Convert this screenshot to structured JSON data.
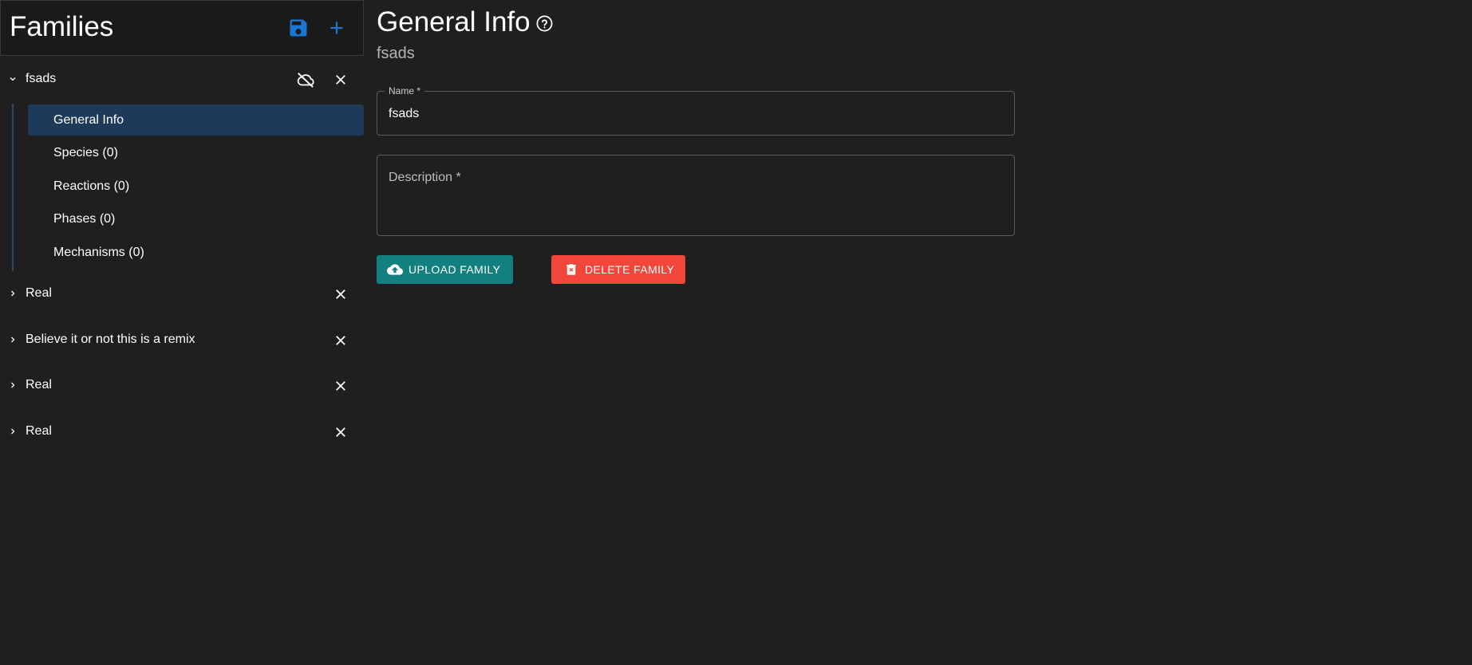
{
  "sidebar": {
    "title": "Families",
    "families": [
      {
        "label": "fsads",
        "expanded": true,
        "cloud_status": "not-uploaded"
      },
      {
        "label": "Real",
        "expanded": false
      },
      {
        "label": "Believe it or not this is a remix",
        "expanded": false
      },
      {
        "label": "Real",
        "expanded": false
      },
      {
        "label": "Real",
        "expanded": false
      }
    ],
    "subitems": [
      {
        "label": "General Info",
        "active": true
      },
      {
        "label": "Species (0)",
        "active": false
      },
      {
        "label": "Reactions (0)",
        "active": false
      },
      {
        "label": "Phases (0)",
        "active": false
      },
      {
        "label": "Mechanisms (0)",
        "active": false
      }
    ]
  },
  "main": {
    "title": "General Info",
    "subtitle": "fsads",
    "name_field": {
      "label": "Name *",
      "value": "fsads"
    },
    "description_field": {
      "placeholder": "Description *",
      "value": ""
    },
    "upload_button": "UPLOAD FAMILY",
    "delete_button": "DELETE FAMILY"
  },
  "colors": {
    "background": "#1f1f1f",
    "accent_blue": "#1976d2",
    "active_item": "#1e3a5a",
    "upload": "#138080",
    "delete": "#f2463a"
  },
  "icons": {
    "save": "floppy-disk-icon",
    "add": "plus-icon",
    "cloud_off": "cloud-off-icon",
    "close": "close-icon",
    "help": "help-circle-icon",
    "upload": "cloud-upload-icon",
    "delete": "trash-icon",
    "expand": "chevron-icon"
  }
}
